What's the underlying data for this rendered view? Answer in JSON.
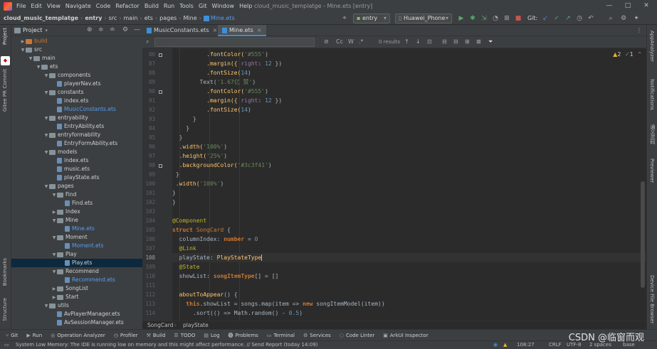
{
  "menubar": {
    "items": [
      "File",
      "Edit",
      "View",
      "Navigate",
      "Code",
      "Refactor",
      "Build",
      "Run",
      "Tools",
      "Git",
      "Window",
      "Help"
    ],
    "title": "cloud_music_templatge - Mine.ets [entry]",
    "window_buttons": [
      "—",
      "□",
      "✕"
    ]
  },
  "navbar": {
    "crumbs": [
      "cloud_music_templatge",
      "entry",
      "src",
      "main",
      "ets",
      "pages",
      "Mine",
      "Mine.ets"
    ],
    "module_select": "entry",
    "device_select": "Huawei_Phone",
    "git_label": "Git:"
  },
  "project_panel": {
    "title": "Project",
    "tree": [
      {
        "label": "build",
        "level": 2,
        "kind": "folder-build",
        "expanded": false
      },
      {
        "label": "src",
        "level": 2,
        "kind": "folder",
        "expanded": true
      },
      {
        "label": "main",
        "level": 3,
        "kind": "folder",
        "expanded": true
      },
      {
        "label": "ets",
        "level": 4,
        "kind": "folder",
        "expanded": true
      },
      {
        "label": "components",
        "level": 5,
        "kind": "folder",
        "expanded": true
      },
      {
        "label": "playerNav.ets",
        "level": 6,
        "kind": "file"
      },
      {
        "label": "constants",
        "level": 5,
        "kind": "folder",
        "expanded": true
      },
      {
        "label": "index.ets",
        "level": 6,
        "kind": "file"
      },
      {
        "label": "MusicConstants.ets",
        "level": 6,
        "kind": "file-blue"
      },
      {
        "label": "entryability",
        "level": 5,
        "kind": "folder",
        "expanded": true
      },
      {
        "label": "EntryAbility.ets",
        "level": 6,
        "kind": "file"
      },
      {
        "label": "entryformability",
        "level": 5,
        "kind": "folder",
        "expanded": true
      },
      {
        "label": "EntryFormAbility.ets",
        "level": 6,
        "kind": "file"
      },
      {
        "label": "models",
        "level": 5,
        "kind": "folder",
        "expanded": true
      },
      {
        "label": "index.ets",
        "level": 6,
        "kind": "file"
      },
      {
        "label": "music.ets",
        "level": 6,
        "kind": "file"
      },
      {
        "label": "playState.ets",
        "level": 6,
        "kind": "file"
      },
      {
        "label": "pages",
        "level": 5,
        "kind": "folder",
        "expanded": true
      },
      {
        "label": "Find",
        "level": 6,
        "kind": "folder",
        "expanded": true
      },
      {
        "label": "Find.ets",
        "level": 7,
        "kind": "file"
      },
      {
        "label": "Index",
        "level": 6,
        "kind": "folder",
        "expanded": false
      },
      {
        "label": "Mine",
        "level": 6,
        "kind": "folder",
        "expanded": true
      },
      {
        "label": "Mine.ets",
        "level": 7,
        "kind": "file-blue"
      },
      {
        "label": "Moment",
        "level": 6,
        "kind": "folder",
        "expanded": true
      },
      {
        "label": "Moment.ets",
        "level": 7,
        "kind": "file-blue"
      },
      {
        "label": "Play",
        "level": 6,
        "kind": "folder",
        "expanded": true
      },
      {
        "label": "Play.ets",
        "level": 7,
        "kind": "file",
        "selected": true
      },
      {
        "label": "Recommend",
        "level": 6,
        "kind": "folder",
        "expanded": true
      },
      {
        "label": "Recommend.ets",
        "level": 7,
        "kind": "file-blue"
      },
      {
        "label": "SongList",
        "level": 6,
        "kind": "folder",
        "expanded": false
      },
      {
        "label": "Start",
        "level": 6,
        "kind": "folder",
        "expanded": false
      },
      {
        "label": "utils",
        "level": 5,
        "kind": "folder",
        "expanded": true
      },
      {
        "label": "AvPlayerManager.ets",
        "level": 6,
        "kind": "file"
      },
      {
        "label": "AvSessionManager.ets",
        "level": 6,
        "kind": "file"
      }
    ]
  },
  "left_stripe": {
    "project": "Project",
    "commit": "Commit",
    "gitee": "Gitee PR",
    "bookmarks": "Bookmarks",
    "structure": "Structure"
  },
  "right_stripe": {
    "appanalyzer": "AppAnalyzer",
    "notifications": "Notifications",
    "preview": "通义灵码",
    "previewer": "Previewer",
    "device_file": "Device File Browser"
  },
  "tabs": [
    {
      "label": "MusicConstants.ets",
      "active": false
    },
    {
      "label": "Mine.ets",
      "active": true
    }
  ],
  "search": {
    "results": "0 results",
    "opts": [
      "Cc",
      "W",
      ".*"
    ]
  },
  "inspections": {
    "warnings": "2",
    "ok": "1"
  },
  "code": {
    "first_line": 86,
    "current_line": 108,
    "lines": [
      [
        [
          "          ",
          "plain"
        ],
        [
          ".fontColor(",
          "fn"
        ],
        [
          "'#555'",
          "str"
        ],
        [
          ")",
          "plain"
        ]
      ],
      [
        [
          "          ",
          "plain"
        ],
        [
          ".margin({ ",
          "fn"
        ],
        [
          "right",
          "prop"
        ],
        [
          ": ",
          "plain"
        ],
        [
          "12",
          "num"
        ],
        [
          " })",
          "plain"
        ]
      ],
      [
        [
          "          ",
          "plain"
        ],
        [
          ".fontSize(",
          "fn"
        ],
        [
          "14",
          "num"
        ],
        [
          ")",
          "plain"
        ]
      ],
      [
        [
          "        ",
          "plain"
        ],
        [
          "Text(",
          "plain"
        ],
        [
          "'1.67亿 赞'",
          "str"
        ],
        [
          ")",
          "plain"
        ]
      ],
      [
        [
          "          ",
          "plain"
        ],
        [
          ".fontColor(",
          "fn"
        ],
        [
          "'#555'",
          "str"
        ],
        [
          ")",
          "plain"
        ]
      ],
      [
        [
          "          ",
          "plain"
        ],
        [
          ".margin({ ",
          "fn"
        ],
        [
          "right",
          "prop"
        ],
        [
          ": ",
          "plain"
        ],
        [
          "12",
          "num"
        ],
        [
          " })",
          "plain"
        ]
      ],
      [
        [
          "          ",
          "plain"
        ],
        [
          ".fontSize(",
          "fn"
        ],
        [
          "14",
          "num"
        ],
        [
          ")",
          "plain"
        ]
      ],
      [
        [
          "      }",
          "plain"
        ]
      ],
      [
        [
          "    }",
          "plain"
        ]
      ],
      [
        [
          "  }",
          "plain"
        ]
      ],
      [
        [
          "  ",
          "plain"
        ],
        [
          ".width(",
          "fn"
        ],
        [
          "'100%'",
          "str"
        ],
        [
          ")",
          "plain"
        ]
      ],
      [
        [
          "  ",
          "plain"
        ],
        [
          ".height(",
          "fn"
        ],
        [
          "'25%'",
          "str"
        ],
        [
          ")",
          "plain"
        ]
      ],
      [
        [
          "  ",
          "plain"
        ],
        [
          ".backgroundColor(",
          "fn"
        ],
        [
          "'#3c3f41'",
          "str"
        ],
        [
          ")",
          "plain"
        ]
      ],
      [
        [
          " }",
          "plain"
        ]
      ],
      [
        [
          " ",
          "plain"
        ],
        [
          ".width(",
          "fn"
        ],
        [
          "'100%'",
          "str"
        ],
        [
          ")",
          "plain"
        ]
      ],
      [
        [
          "}",
          "plain"
        ]
      ],
      [
        [
          "}",
          "plain"
        ]
      ],
      [
        [
          "",
          "plain"
        ]
      ],
      [
        [
          "@Component",
          "dec"
        ]
      ],
      [
        [
          "struct ",
          "kw"
        ],
        [
          "SongCard ",
          "cls"
        ],
        [
          "{",
          "plain"
        ]
      ],
      [
        [
          "  columnIndex",
          "plain"
        ],
        [
          ": ",
          "plain"
        ],
        [
          "number",
          "kw"
        ],
        [
          " = ",
          "plain"
        ],
        [
          "0",
          "num"
        ]
      ],
      [
        [
          "  @Link",
          "dec"
        ]
      ],
      [
        [
          "  playState",
          "plain"
        ],
        [
          ": ",
          "plain"
        ],
        [
          "PlayStateType",
          "yel"
        ]
      ],
      [
        [
          "  @State",
          "dec"
        ]
      ],
      [
        [
          "  showList",
          "plain"
        ],
        [
          ": ",
          "plain"
        ],
        [
          "songItemType",
          "kw"
        ],
        [
          "[] = []",
          "plain"
        ]
      ],
      [
        [
          "",
          "plain"
        ]
      ],
      [
        [
          "  aboutToAppear",
          "fn"
        ],
        [
          "() {",
          "plain"
        ]
      ],
      [
        [
          "    ",
          "plain"
        ],
        [
          "this",
          "kw"
        ],
        [
          ".showList = songs.map(item => ",
          "plain"
        ],
        [
          "new ",
          "kw"
        ],
        [
          "songItemModel",
          "plain"
        ],
        [
          "(item))",
          "plain"
        ]
      ],
      [
        [
          "      .sort(() => Math.random() - ",
          "plain"
        ],
        [
          "0.5",
          "num"
        ],
        [
          ")",
          "plain"
        ]
      ]
    ]
  },
  "gutter_marks": [
    86,
    90,
    98
  ],
  "crumbbar": [
    "SongCard",
    "playState"
  ],
  "bottom_tools": [
    {
      "icon": "git-icon",
      "glyph": "⑂",
      "label": "Git"
    },
    {
      "icon": "run-icon",
      "glyph": "▶",
      "label": "Run"
    },
    {
      "icon": "operation-analyzer-icon",
      "glyph": "◎",
      "label": "Operation Analyzer"
    },
    {
      "icon": "profiler-icon",
      "glyph": "◷",
      "label": "Profiler"
    },
    {
      "icon": "build-icon",
      "glyph": "⚒",
      "label": "Build"
    },
    {
      "icon": "todo-icon",
      "glyph": "☰",
      "label": "TODO"
    },
    {
      "icon": "log-icon",
      "glyph": "▤",
      "label": "Log"
    },
    {
      "icon": "problems-icon",
      "glyph": "⓿",
      "label": "Problems"
    },
    {
      "icon": "terminal-icon",
      "glyph": "▭",
      "label": "Terminal"
    },
    {
      "icon": "services-icon",
      "glyph": "⚙",
      "label": "Services"
    },
    {
      "icon": "code-linter-icon",
      "glyph": "◌",
      "label": "Code Linter"
    },
    {
      "icon": "arkui-inspector-icon",
      "glyph": "▣",
      "label": "ArkUI Inspector"
    }
  ],
  "statusbar": {
    "message": "System Low Memory: The IDE is running low on memory and this might affect performance. // Send Report (today 14:09)",
    "position": "108:27",
    "line_sep": "CRLF",
    "encoding": "UTF-8",
    "indent": "2 spaces",
    "branch": "base"
  },
  "watermark": "CSDN @临窗而观",
  "colors": {
    "accent": "#4a88c7",
    "selection": "#0d293e",
    "editor_bg": "#2b2b2b",
    "panel_bg": "#3c3f41"
  }
}
